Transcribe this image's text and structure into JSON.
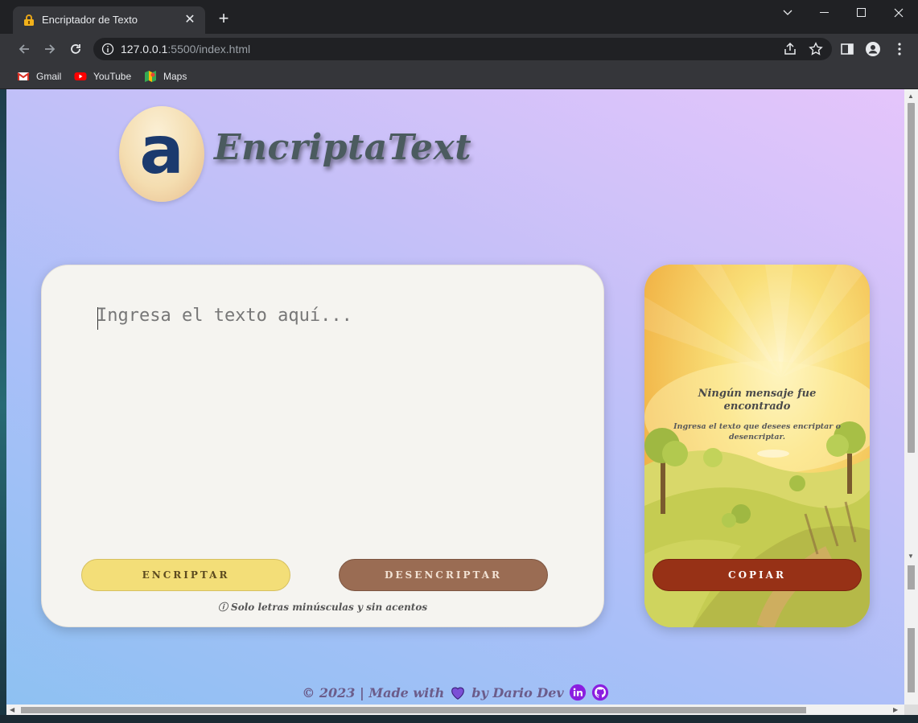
{
  "browser": {
    "tab_title": "Encriptador de Texto",
    "url_host": "127.0.0.1",
    "url_rest": ":5500/index.html",
    "bookmarks": [
      {
        "label": "Gmail",
        "icon": "gmail-icon"
      },
      {
        "label": "YouTube",
        "icon": "youtube-icon"
      },
      {
        "label": "Maps",
        "icon": "maps-icon"
      }
    ]
  },
  "page": {
    "logo_letter": "a",
    "brand": "EncriptaText",
    "input_placeholder": "Ingresa el texto aquí...",
    "encrypt_label": "ENCRIPTAR",
    "decrypt_label": "DESENCRIPTAR",
    "hint": "ⓘ Solo letras minúsculas y sin acentos",
    "output_title": "Ningún mensaje fue encontrado",
    "output_subtitle": "Ingresa el texto que desees encriptar o desencriptar.",
    "copy_label": "COPIAR",
    "footer_left": "© 2023 | Made with",
    "footer_right": "by Dario Dev"
  },
  "colors": {
    "encrypt_button": "#f3de78",
    "decrypt_button": "#9a6c53",
    "copy_button": "#973116",
    "heart": "#7b4fd6",
    "social": "#8a1ee0"
  }
}
